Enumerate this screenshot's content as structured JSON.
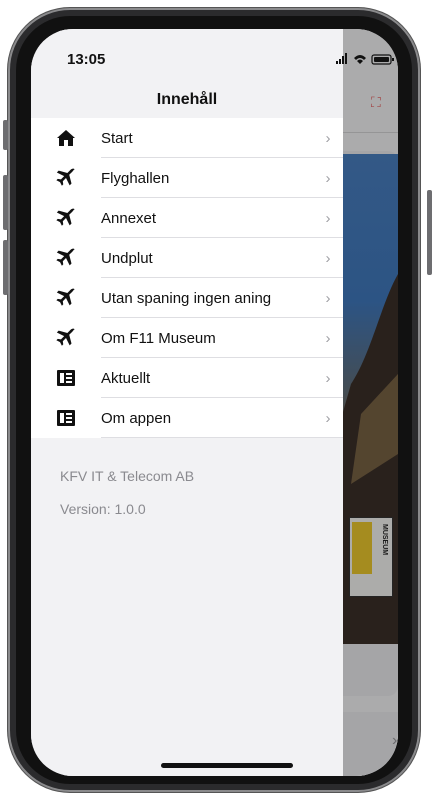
{
  "status": {
    "time": "13:05",
    "icons": "signal wifi battery"
  },
  "drawer": {
    "title": "Innehåll",
    "items": [
      {
        "label": "Start",
        "icon": "home-icon"
      },
      {
        "label": "Flyghallen",
        "icon": "airplane-icon"
      },
      {
        "label": "Annexet",
        "icon": "airplane-icon"
      },
      {
        "label": "Undplut",
        "icon": "airplane-icon"
      },
      {
        "label": "Utan spaning ingen aning",
        "icon": "airplane-icon"
      },
      {
        "label": "Om F11 Museum",
        "icon": "airplane-icon"
      },
      {
        "label": "Aktuellt",
        "icon": "news-icon"
      },
      {
        "label": "Om appen",
        "icon": "news-icon"
      }
    ],
    "company": "KFV IT & Telecom AB",
    "version": "Version: 1.0.0"
  },
  "background": {
    "museum_label": "MUSEUM"
  },
  "colors": {
    "accent": "#e35b5b",
    "drawer_bg": "#f2f2f4",
    "text": "#111111",
    "muted": "#8a8a8f"
  }
}
